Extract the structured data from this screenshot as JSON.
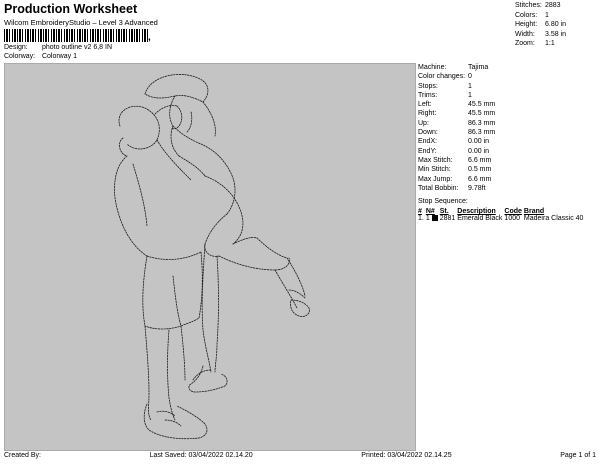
{
  "header": {
    "title": "Production Worksheet",
    "subtitle": "Wilcom EmbroideryStudio – Level 3 Advanced",
    "barcode_tail": ","
  },
  "meta": {
    "design_label": "Design:",
    "design_value": "photo outline v2 6,8 IN",
    "colorway_label": "Colorway:",
    "colorway_value": "Colorway 1"
  },
  "stats": [
    {
      "label": "Stitches:",
      "value": "2883"
    },
    {
      "label": "Colors:",
      "value": "1"
    },
    {
      "label": "Height:",
      "value": "6.80 in"
    },
    {
      "label": "Width:",
      "value": "3.58 in"
    },
    {
      "label": "Zoom:",
      "value": "1:1"
    }
  ],
  "info": [
    {
      "label": "Machine:",
      "value": "Tajima"
    },
    {
      "label": "Color changes:",
      "value": "0"
    },
    {
      "label": "Stops:",
      "value": "1"
    },
    {
      "label": "Trims:",
      "value": "1"
    },
    {
      "label": "Left:",
      "value": "45.5 mm"
    },
    {
      "label": "Right:",
      "value": "45.5 mm"
    },
    {
      "label": "Up:",
      "value": "86.3 mm"
    },
    {
      "label": "Down:",
      "value": "86.3 mm"
    },
    {
      "label": "EndX:",
      "value": "0.00 in"
    },
    {
      "label": "EndY:",
      "value": "0.00 in"
    },
    {
      "label": "Max Stitch:",
      "value": "6.6 mm"
    },
    {
      "label": "Min Stitch:",
      "value": "0.5 mm"
    },
    {
      "label": "Max Jump:",
      "value": "6.6 mm"
    },
    {
      "label": "Total Bobbin:",
      "value": "9.78ft"
    }
  ],
  "stop_sequence": {
    "title": "Stop Sequence:",
    "headers": [
      "#",
      "N#",
      "St.",
      "Description",
      "Code",
      "Brand"
    ],
    "rows": [
      {
        "num": "1.",
        "n": "1",
        "color": "#050505",
        "st": "2881",
        "description": "Emerald Black",
        "code": "1000",
        "brand": "Madeira Classic 40"
      }
    ]
  },
  "footer": {
    "created_by": "Created By:",
    "last_saved": "Last Saved: 03/04/2022 02.14.20",
    "printed": "Printed: 03/04/2022 02.14.25",
    "page": "Page 1 of 1"
  },
  "colors": {
    "canvas_bg": "#c4c4c4",
    "stitch": "#1a1a1a"
  }
}
